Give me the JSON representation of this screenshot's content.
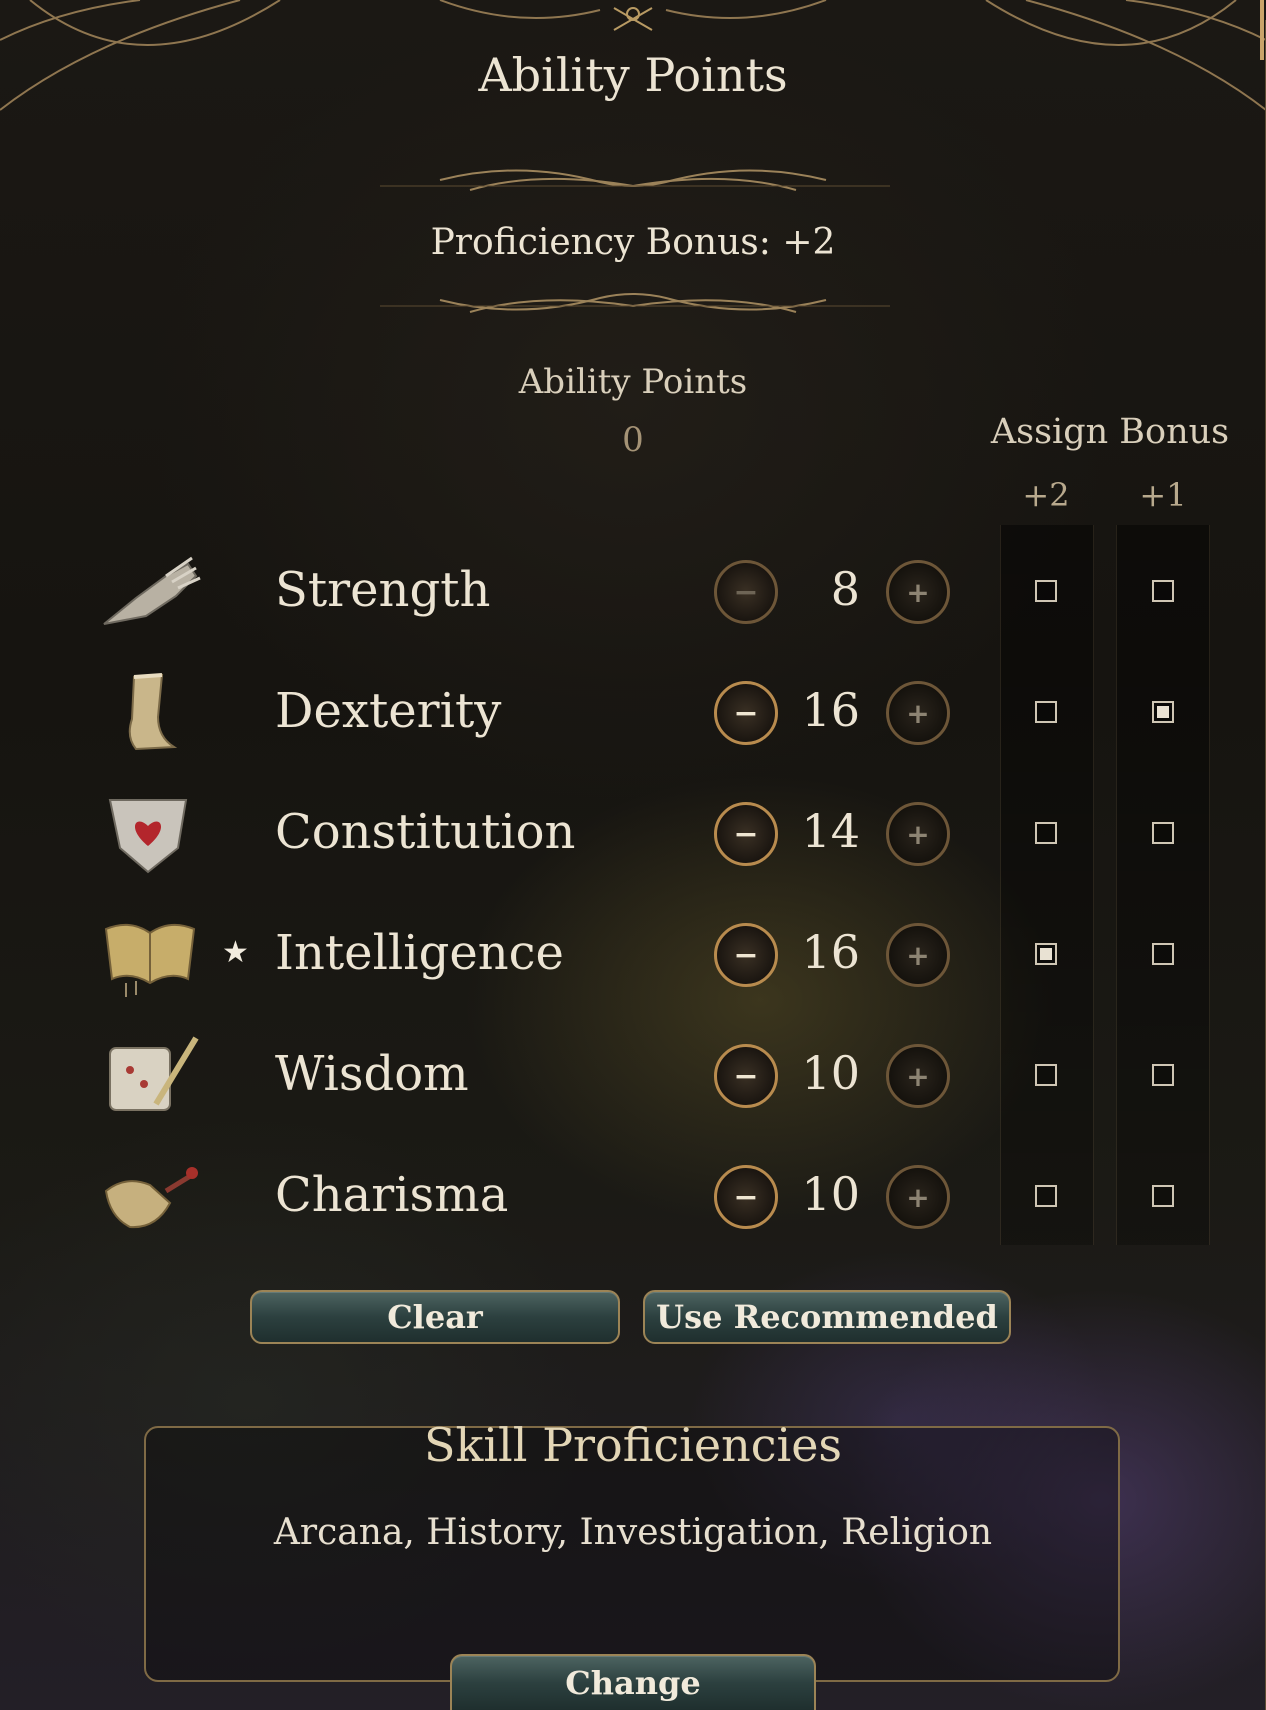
{
  "title": "Ability Points",
  "proficiency": "Proficiency Bonus: +2",
  "ability_points": {
    "label": "Ability Points",
    "remaining": "0"
  },
  "assign_bonus": {
    "label": "Assign Bonus",
    "col_plus2": "+2",
    "col_plus1": "+1"
  },
  "abilities": [
    {
      "name": "Strength",
      "score": "8",
      "icon": "gauntlet-icon",
      "starred": false,
      "bonus_plus2": false,
      "bonus_plus1": false,
      "can_decrease": false
    },
    {
      "name": "Dexterity",
      "score": "16",
      "icon": "boot-icon",
      "starred": false,
      "bonus_plus2": false,
      "bonus_plus1": true,
      "can_decrease": true
    },
    {
      "name": "Constitution",
      "score": "14",
      "icon": "heart-shield-icon",
      "starred": false,
      "bonus_plus2": false,
      "bonus_plus1": false,
      "can_decrease": true
    },
    {
      "name": "Intelligence",
      "score": "16",
      "icon": "open-book-icon",
      "starred": true,
      "bonus_plus2": true,
      "bonus_plus1": false,
      "can_decrease": true
    },
    {
      "name": "Wisdom",
      "score": "10",
      "icon": "scroll-quill-icon",
      "starred": false,
      "bonus_plus2": false,
      "bonus_plus1": false,
      "can_decrease": true
    },
    {
      "name": "Charisma",
      "score": "10",
      "icon": "hand-rose-icon",
      "starred": false,
      "bonus_plus2": false,
      "bonus_plus1": false,
      "can_decrease": true
    }
  ],
  "star_glyph": "★",
  "buttons": {
    "clear": "Clear",
    "use_recommended": "Use Recommended",
    "change": "Change"
  },
  "skills": {
    "title": "Skill Proficiencies",
    "list": "Arcana, History, Investigation, Religion"
  },
  "colors": {
    "gold_trim": "#b88b4e",
    "button_teal": "#2c403f",
    "text": "#ece4d3"
  }
}
